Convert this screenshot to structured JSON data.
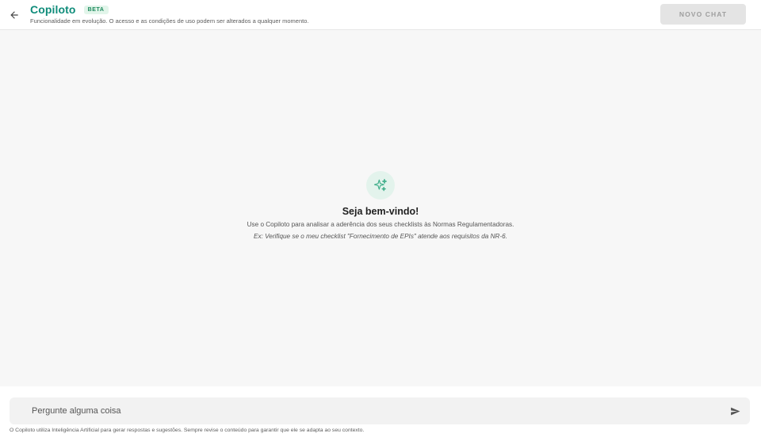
{
  "header": {
    "back_icon": "arrow-left-icon",
    "title": "Copiloto",
    "badge": "BETA",
    "subtitle": "Funcionalidade em evolução. O acesso e as condições de uso podem ser alterados a qualquer momento.",
    "new_chat_label": "NOVO CHAT",
    "brand_color": "#0f8c7a"
  },
  "welcome": {
    "icon": "sparkle-icon",
    "title": "Seja bem-vindo!",
    "description": "Use o Copiloto para analisar a aderência dos seus checklists às Normas Regulamentadoras.",
    "example": "Ex: Verifique se o meu checklist \"Fornecimento de EPIs\" atende aos requisitos da NR-6."
  },
  "composer": {
    "placeholder": "Pergunte alguma coisa",
    "value": "",
    "send_icon": "send-icon",
    "disclaimer": "O Copiloto utiliza Inteligência Artificial para gerar respostas e sugestões. Sempre revise o conteúdo para garantir que ele se adapta ao seu contexto."
  }
}
